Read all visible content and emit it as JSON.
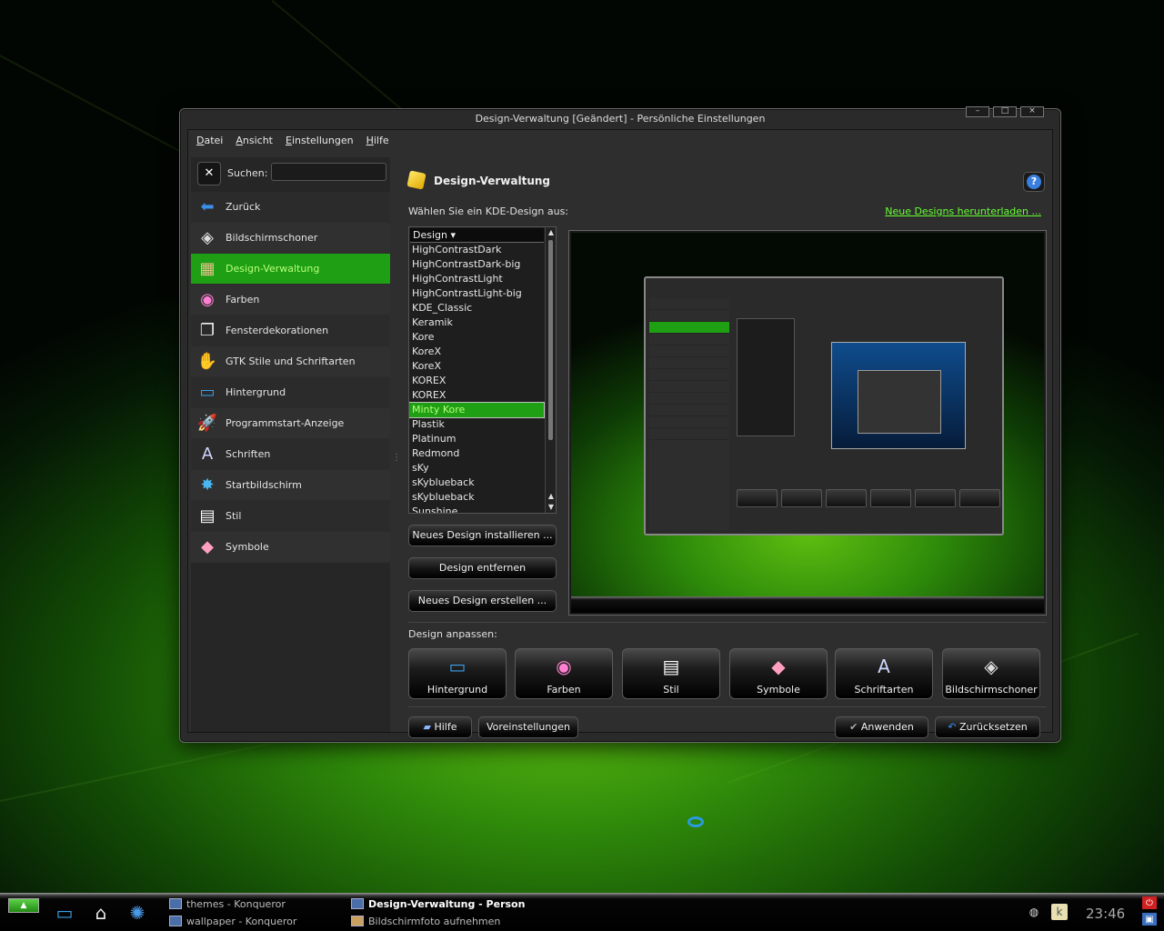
{
  "window": {
    "title": "Design-Verwaltung [Geändert] - Persönliche Einstellungen",
    "controls": [
      "–",
      "□",
      "×"
    ]
  },
  "menu": {
    "items": [
      {
        "label": "Datei",
        "accel": "D",
        "rest": "atei"
      },
      {
        "label": "Ansicht",
        "accel": "A",
        "rest": "nsicht"
      },
      {
        "label": "Einstellungen",
        "accel": "E",
        "rest": "instellungen"
      },
      {
        "label": "Hilfe",
        "accel": "H",
        "rest": "ilfe"
      }
    ]
  },
  "search": {
    "label": "Suchen:",
    "value": "",
    "clear_glyph": "✕"
  },
  "sidebar": {
    "items": [
      {
        "label": "Zurück",
        "icon": "back-arrow-icon",
        "glyph": "⬅",
        "color": "#3a8fe8"
      },
      {
        "label": "Bildschirmschoner",
        "icon": "screensaver-icon",
        "glyph": "◈",
        "color": "#dddddd"
      },
      {
        "label": "Design-Verwaltung",
        "icon": "theme-manager-icon",
        "glyph": "▦",
        "color": "#e7c38a"
      },
      {
        "label": "Farben",
        "icon": "colors-icon",
        "glyph": "◉",
        "color": "#ff7fd0"
      },
      {
        "label": "Fensterdekorationen",
        "icon": "window-decorations-icon",
        "glyph": "❐",
        "color": "#eeeeee"
      },
      {
        "label": "GTK Stile und Schriftarten",
        "icon": "gtk-styles-icon",
        "glyph": "✋",
        "color": "#f0a020"
      },
      {
        "label": "Hintergrund",
        "icon": "background-icon",
        "glyph": "▭",
        "color": "#3aa0e8"
      },
      {
        "label": "Programmstart-Anzeige",
        "icon": "launch-feedback-icon",
        "glyph": "🚀",
        "color": "#dddddd"
      },
      {
        "label": "Schriften",
        "icon": "fonts-icon",
        "glyph": "A",
        "color": "#cfd8ff"
      },
      {
        "label": "Startbildschirm",
        "icon": "splash-screen-icon",
        "glyph": "✸",
        "color": "#4ab8f0"
      },
      {
        "label": "Stil",
        "icon": "style-icon",
        "glyph": "▤",
        "color": "#ffffff"
      },
      {
        "label": "Symbole",
        "icon": "icons-icon",
        "glyph": "◆",
        "color": "#ffa0c0"
      }
    ],
    "active_index": 2
  },
  "content": {
    "title": "Design-Verwaltung",
    "help_glyph": "?",
    "choose_label": "Wählen Sie ein KDE-Design aus:",
    "download_link": "Neue Designs herunterladen ...",
    "list_header": "Design",
    "themes": [
      "HighContrastDark",
      "HighContrastDark-big",
      "HighContrastLight",
      "HighContrastLight-big",
      "KDE_Classic",
      "Keramik",
      "Kore",
      "KoreX",
      "KoreX",
      "KOREX",
      "KOREX",
      "Minty Kore",
      "Plastik",
      "Platinum",
      "Redmond",
      "sKy",
      "sKyblueback",
      "sKyblueback",
      "Sunshine"
    ],
    "selected_theme_index": 11,
    "buttons": {
      "install": "Neues Design installieren ...",
      "remove": "Design entfernen",
      "create": "Neues Design erstellen ..."
    },
    "customize_label": "Design anpassen:",
    "tiles": [
      {
        "label": "Hintergrund",
        "icon": "background-icon",
        "glyph": "▭",
        "color": "#3aa0e8"
      },
      {
        "label": "Farben",
        "icon": "colors-icon",
        "glyph": "◉",
        "color": "#ff7fd0"
      },
      {
        "label": "Stil",
        "icon": "style-icon",
        "glyph": "▤",
        "color": "#ffffff"
      },
      {
        "label": "Symbole",
        "icon": "icons-icon",
        "glyph": "◆",
        "color": "#ffa0c0"
      },
      {
        "label": "Schriftarten",
        "icon": "fonts-icon",
        "glyph": "A",
        "color": "#cfd8ff"
      },
      {
        "label": "Bildschirmschoner",
        "icon": "screensaver-icon",
        "glyph": "◈",
        "color": "#dddddd"
      }
    ],
    "bottom_buttons": {
      "help": "Hilfe",
      "defaults": "Voreinstellungen",
      "apply": "Anwenden",
      "reset": "Zurücksetzen"
    }
  },
  "taskbar": {
    "tasks": [
      {
        "label": "themes - Konqueror"
      },
      {
        "label": "wallpaper - Konqueror"
      },
      {
        "label": "Design-Verwaltung - Person"
      },
      {
        "label": "Bildschirmfoto aufnehmen"
      }
    ],
    "clock": "23:46"
  }
}
